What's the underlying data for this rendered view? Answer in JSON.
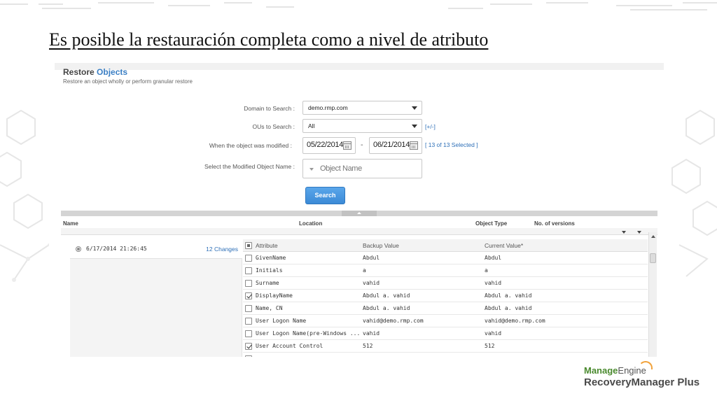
{
  "slide": {
    "title": "Es posible la restauración completa como a nivel de atributo"
  },
  "page": {
    "heading_prefix": "Restore",
    "heading_accent": "Objects",
    "subtitle": "Restore an object wholly or perform granular restore"
  },
  "form": {
    "domain_label": "Domain to Search :",
    "domain_value": "demo.rmp.com",
    "ous_label": "OUs to Search :",
    "ous_value": "All",
    "ous_toggle": "[+/-]",
    "modified_label": "When the object was modified :",
    "date_from": "05/22/2014",
    "date_separator": "-",
    "date_to": "06/21/2014",
    "selected_link": "[ 13 of 13 Selected ]",
    "object_name_label": "Select the Modified Object Name :",
    "object_name_placeholder": "Object Name",
    "search_button": "Search"
  },
  "results": {
    "columns": {
      "name": "Name",
      "location": "Location",
      "object_type": "Object Type",
      "versions": "No. of versions"
    }
  },
  "versions": [
    {
      "date": "6/17/2014 21:26:45",
      "changes": "12 Changes"
    }
  ],
  "attributes": {
    "headers": {
      "attribute": "Attribute",
      "backup": "Backup Value",
      "current": "Current Value*"
    },
    "rows": [
      {
        "name": "GivenName",
        "backup": "Abdul",
        "current": "Abdul",
        "checked": false
      },
      {
        "name": "Initials",
        "backup": "a",
        "current": "a",
        "checked": false
      },
      {
        "name": "Surname",
        "backup": "vahid",
        "current": "vahid",
        "checked": false
      },
      {
        "name": "DisplayName",
        "backup": "Abdul a. vahid",
        "current": "Abdul a. vahid",
        "checked": true
      },
      {
        "name": "Name, CN",
        "backup": "Abdul a. vahid",
        "current": "Abdul a. vahid",
        "checked": false
      },
      {
        "name": "User Logon Name",
        "backup": "vahid@demo.rmp.com",
        "current": "vahid@demo.rmp.com",
        "checked": false
      },
      {
        "name": "User Logon Name(pre-Windows ...",
        "backup": "vahid",
        "current": "vahid",
        "checked": false
      },
      {
        "name": "User Account Control",
        "backup": "512",
        "current": "512",
        "checked": true
      }
    ]
  },
  "logo": {
    "brand_bold": "Manage",
    "brand_light": "Engine",
    "product": "RecoveryManager Plus"
  },
  "colors": {
    "accent": "#3b7fc4",
    "link": "#2d6fb7",
    "button": "#3b8ad6",
    "logo_green": "#4a8a2e",
    "logo_orange": "#f2a23a"
  }
}
